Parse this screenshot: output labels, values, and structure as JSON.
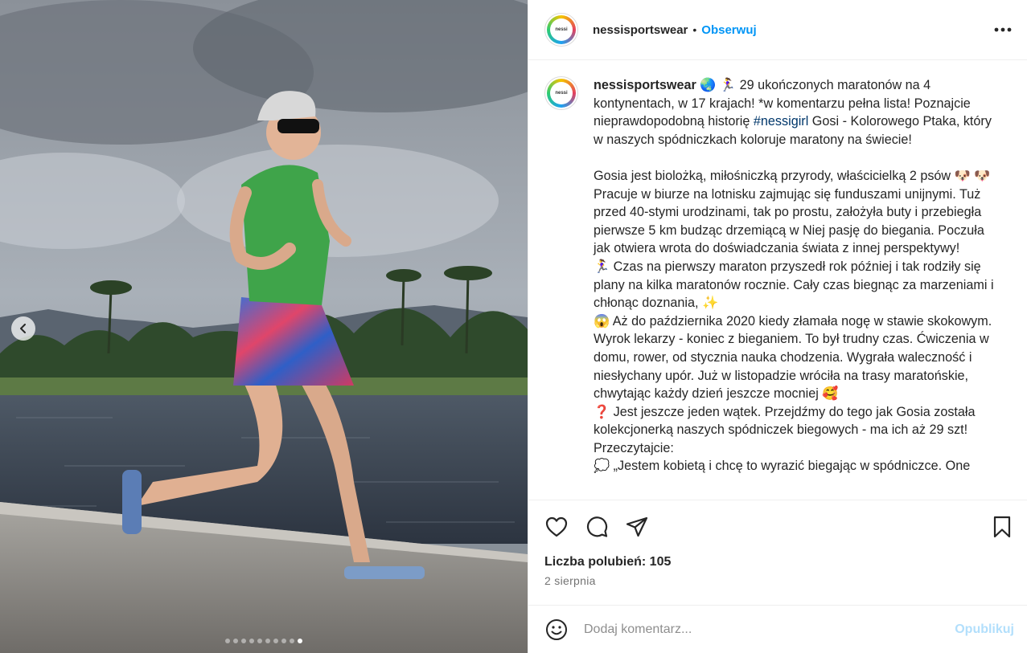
{
  "post": {
    "username": "nessisportswear",
    "separator": "•",
    "follow_label": "Obserwuj",
    "avatar_text": "nessi"
  },
  "caption": {
    "username": "nessisportswear",
    "p1_emoji": "🌏 🏃‍♀️",
    "p1": "29 ukończonych maratonów na 4 kontynentach, w 17 krajach! *w komentarzu pełna lista! Poznajcie nieprawdopodobną historię",
    "hashtag": "#nessigirl",
    "p1_tail": "Gosi - Kolorowego Ptaka, który w naszych spódniczkach koloruje maratony na świecie!",
    "p2": "Gosia jest biolożką, miłośniczką przyrody, właścicielką 2 psów 🐶 🐶  Pracuje w biurze na lotnisku zajmując się funduszami unijnymi. Tuż przed 40-stymi urodzinami, tak po prostu, założyła buty i przebiegła pierwsze 5 km budząc drzemiącą w Niej pasję do biegania. Poczuła jak otwiera wrota do doświadczania świata z innej perspektywy!",
    "p3": "🏃‍♀️  Czas na pierwszy maraton przyszedł rok później i tak rodziły się plany na kilka maratonów rocznie. Cały czas biegnąc za marzeniami i chłonąc doznania, ✨",
    "p4": "😱  Aż do października 2020 kiedy złamała nogę w stawie skokowym. Wyrok lekarzy - koniec z bieganiem. To był trudny czas. Ćwiczenia w domu, rower, od stycznia nauka chodzenia. Wygrała waleczność i niesłychany upór. Już w listopadzie wróciła na trasy maratońskie, chwytając każdy dzień jeszcze mocniej 🥰",
    "p5": "❓  Jest jeszcze jeden wątek. Przejdźmy do tego jak Gosia została kolekcjonerką naszych spódniczek biegowych - ma ich aż 29 szt! Przeczytajcie:",
    "p6": "💭  „Jestem kobietą i chcę to wyrazić biegając w spódniczce. One"
  },
  "stats": {
    "likes": "Liczba polubień: 105",
    "date": "2 sierpnia"
  },
  "comment": {
    "placeholder": "Dodaj komentarz...",
    "publish_label": "Opublikuj"
  },
  "icons": {
    "more": "more-options-icon",
    "like": "heart-icon",
    "comment": "comment-icon",
    "share": "share-icon",
    "save": "bookmark-icon",
    "emoji": "emoji-icon",
    "prev": "chevron-left-icon"
  },
  "carousel": {
    "total": 10,
    "active": 9
  },
  "colors": {
    "link": "#0095f6",
    "hashtag": "#00376b",
    "muted": "#737373",
    "publish_disabled": "#b2dffc"
  }
}
